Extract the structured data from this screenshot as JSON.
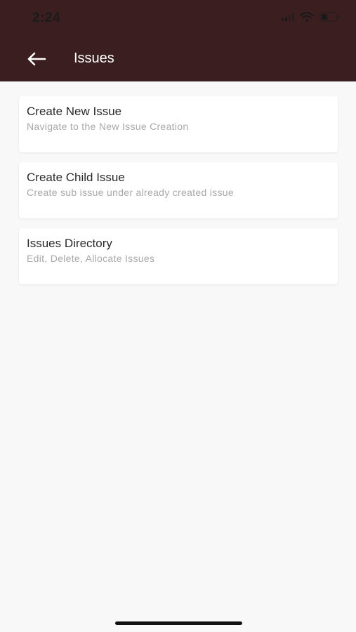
{
  "status_bar": {
    "time": "2:24"
  },
  "nav": {
    "title": "Issues"
  },
  "cards": [
    {
      "title": "Create New Issue",
      "subtitle": "Navigate to the New Issue Creation"
    },
    {
      "title": "Create Child Issue",
      "subtitle": "Create sub issue under already created issue"
    },
    {
      "title": "Issues Directory",
      "subtitle": "Edit, Delete, Allocate Issues"
    }
  ],
  "icons": {
    "back": "arrow-left-icon",
    "signal": "cellular-signal-icon",
    "wifi": "wifi-icon",
    "battery": "battery-icon"
  },
  "colors": {
    "header": "#3b1e20",
    "background": "#f8f8f8",
    "card": "#ffffff",
    "title_text": "#2a2a2a",
    "subtitle_text": "#a8a8a8"
  }
}
